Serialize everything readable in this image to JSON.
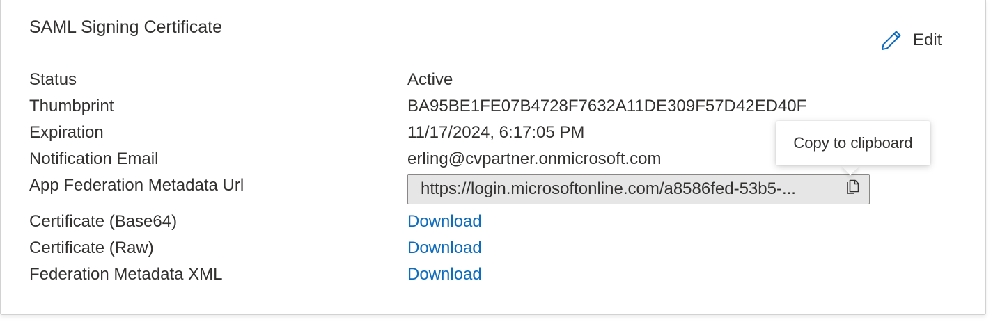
{
  "card": {
    "title": "SAML Signing Certificate",
    "edit_label": "Edit"
  },
  "rows": [
    {
      "label": "Status",
      "value": "Active"
    },
    {
      "label": "Thumbprint",
      "value": "BA95BE1FE07B4728F7632A11DE309F57D42ED40F"
    },
    {
      "label": "Expiration",
      "value": "11/17/2024, 6:17:05 PM"
    },
    {
      "label": "Notification Email",
      "value": "erling@cvpartner.onmicrosoft.com"
    },
    {
      "label": "App Federation Metadata Url",
      "value": "https://login.microsoftonline.com/a8586fed-53b5-..."
    },
    {
      "label": "Certificate (Base64)",
      "value": "Download"
    },
    {
      "label": "Certificate (Raw)",
      "value": "Download"
    },
    {
      "label": "Federation Metadata XML",
      "value": "Download"
    }
  ],
  "tooltip": {
    "text": "Copy to clipboard"
  },
  "icons": {
    "edit": "pencil-icon",
    "copy": "copy-icon"
  },
  "colors": {
    "link": "#0f6cbd",
    "text": "#323130",
    "input_bg": "#e6e6e6",
    "input_border": "#8a8886"
  }
}
